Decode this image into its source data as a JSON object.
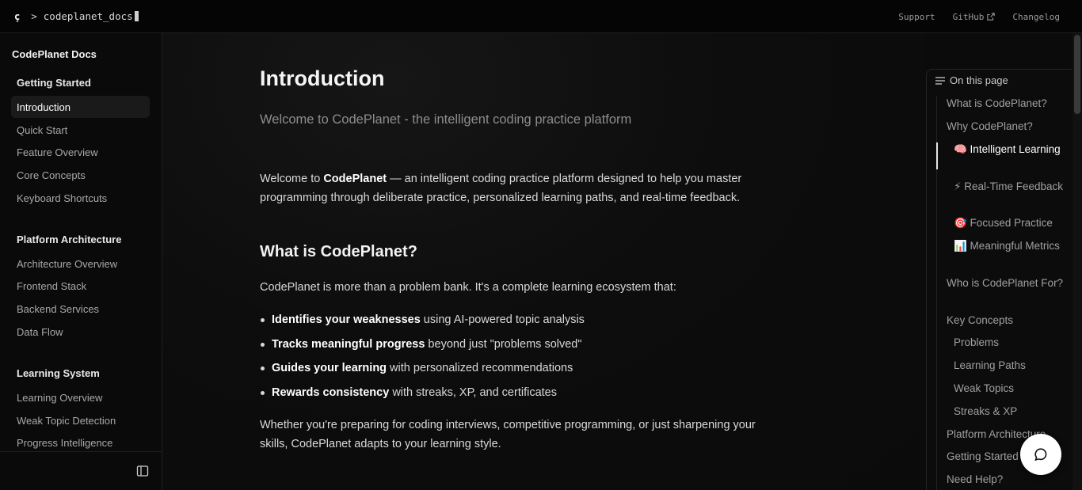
{
  "topbar": {
    "logo": "ç",
    "prompt": ">",
    "site_name": "codeplanet_docs",
    "nav": [
      {
        "label": "Support"
      },
      {
        "label": "GitHub"
      },
      {
        "label": "Changelog"
      }
    ]
  },
  "sidebar": {
    "title": "CodePlanet Docs",
    "groups": [
      {
        "title": "Getting Started",
        "items": [
          {
            "label": "Introduction",
            "active": true
          },
          {
            "label": "Quick Start"
          },
          {
            "label": "Feature Overview"
          },
          {
            "label": "Core Concepts"
          },
          {
            "label": "Keyboard Shortcuts"
          }
        ]
      },
      {
        "title": "Platform Architecture",
        "items": [
          {
            "label": "Architecture Overview"
          },
          {
            "label": "Frontend Stack"
          },
          {
            "label": "Backend Services"
          },
          {
            "label": "Data Flow"
          }
        ]
      },
      {
        "title": "Learning System",
        "items": [
          {
            "label": "Learning Overview"
          },
          {
            "label": "Weak Topic Detection"
          },
          {
            "label": "Progress Intelligence"
          }
        ]
      }
    ]
  },
  "main": {
    "title": "Introduction",
    "subtitle": "Welcome to CodePlanet - the intelligent coding practice platform",
    "intro": {
      "before": "Welcome to ",
      "bold": "CodePlanet",
      "after": " — an intelligent coding practice platform designed to help you master programming through deliberate practice, personalized learning paths, and real-time feedback."
    },
    "section_title": "What is CodePlanet?",
    "section_lead": "CodePlanet is more than a problem bank. It's a complete learning ecosystem that:",
    "bullets": [
      {
        "bold": "Identifies your weaknesses",
        "rest": " using AI-powered topic analysis"
      },
      {
        "bold": "Tracks meaningful progress",
        "rest": " beyond just \"problems solved\""
      },
      {
        "bold": "Guides your learning",
        "rest": " with personalized recommendations"
      },
      {
        "bold": "Rewards consistency",
        "rest": " with streaks, XP, and certificates"
      }
    ],
    "closing": "Whether you're preparing for coding interviews, competitive programming, or just sharpening your skills, CodePlanet adapts to your learning style."
  },
  "toc": {
    "heading": "On this page",
    "items": [
      {
        "label": "What is CodePlanet?"
      },
      {
        "label": "Why CodePlanet?"
      },
      {
        "label": "🧠 Intelligent Learning",
        "active": true
      },
      {
        "label": "⚡ Real-Time Feedback"
      },
      {
        "label": "🎯 Focused Practice"
      },
      {
        "label": "📊 Meaningful Metrics"
      },
      {
        "label": "Who is CodePlanet For?"
      },
      {
        "label": "Key Concepts"
      },
      {
        "label": "Problems"
      },
      {
        "label": "Learning Paths"
      },
      {
        "label": "Weak Topics"
      },
      {
        "label": "Streaks & XP"
      },
      {
        "label": "Platform Architecture"
      },
      {
        "label": "Getting Started"
      },
      {
        "label": "Need Help?"
      }
    ]
  },
  "colors": {
    "background": "#0b0b0b",
    "text": "#e6e6e6",
    "muted": "#a0a0a0",
    "chat_button": "#ffffff"
  },
  "icons": {
    "logo": "logo-icon",
    "external": "external-link-icon",
    "toc": "list-icon",
    "sidebar_toggle": "sidebar-toggle-icon",
    "chat": "chat-bubble-icon"
  }
}
